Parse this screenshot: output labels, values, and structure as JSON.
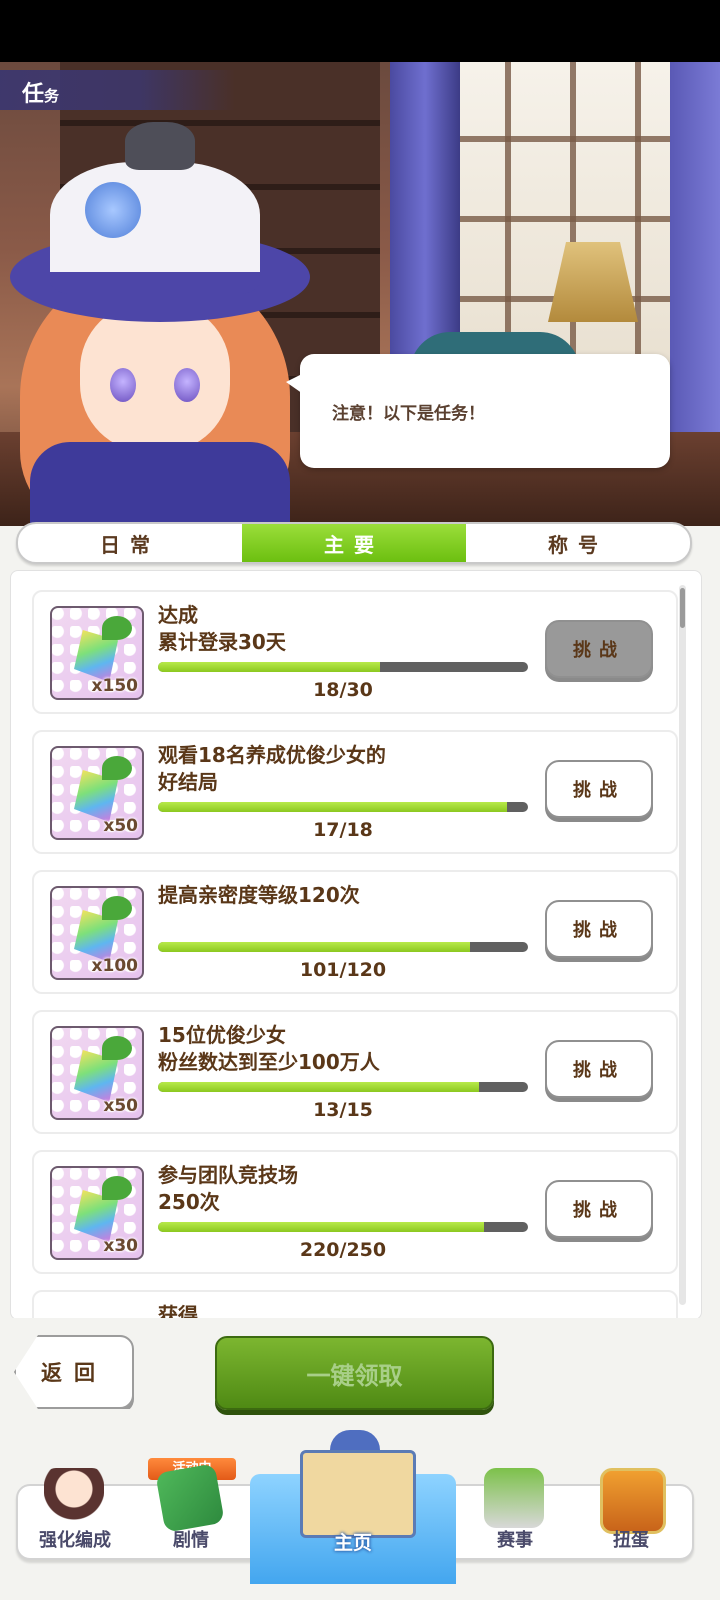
{
  "header": {
    "title_main": "任",
    "title_small": "务"
  },
  "dialog": {
    "text": "注意！以下是任务！"
  },
  "tabs": [
    {
      "label": "日常",
      "active": false
    },
    {
      "label": "主要",
      "active": true
    },
    {
      "label": "称号",
      "active": false
    }
  ],
  "missions": [
    {
      "title": "达成\n累计登录30天",
      "qty": "x150",
      "progress_text": "18/30",
      "progress": 0.6,
      "button": "挑战"
    },
    {
      "title": "观看18名养成优俊少女的\n好结局",
      "qty": "x50",
      "progress_text": "17/18",
      "progress": 0.944,
      "button": "挑战"
    },
    {
      "title": "提高亲密度等级120次",
      "qty": "x100",
      "progress_text": "101/120",
      "progress": 0.842,
      "button": "挑战"
    },
    {
      "title": "15位优俊少女\n粉丝数达到至少100万人",
      "qty": "x50",
      "progress_text": "13/15",
      "progress": 0.867,
      "button": "挑战"
    },
    {
      "title": "参与团队竞技场\n250次",
      "qty": "x30",
      "progress_text": "220/250",
      "progress": 0.88,
      "button": "挑战"
    }
  ],
  "partial_mission": {
    "title": "获得"
  },
  "actions": {
    "back": "返回",
    "claim_all": "一键领取"
  },
  "nav": {
    "event_badge": "活动中",
    "items": [
      {
        "label": "强化编成",
        "icon": "character-icon"
      },
      {
        "label": "剧情",
        "icon": "story-book-icon"
      },
      {
        "label": "主页",
        "icon": "home-building-icon"
      },
      {
        "label": "赛事",
        "icon": "race-gate-icon"
      },
      {
        "label": "扭蛋",
        "icon": "gacha-icon"
      }
    ]
  },
  "colors": {
    "accent_green": "#7cc21a",
    "text_brown": "#5a3718",
    "nav_blue": "#43a6ef"
  }
}
